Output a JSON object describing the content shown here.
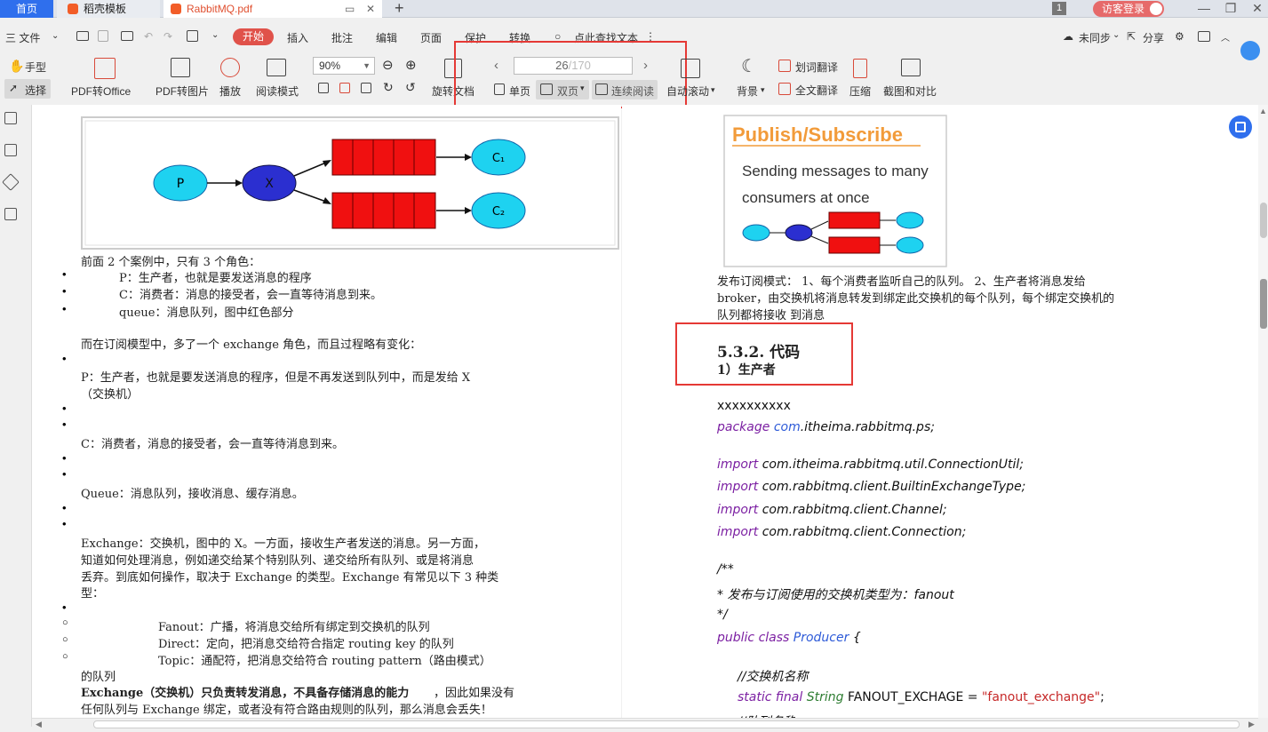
{
  "tabs": {
    "home": "首页",
    "template": "稻壳模板",
    "pdf": "RabbitMQ.pdf",
    "add": "+"
  },
  "titlebar": {
    "badge": "1",
    "login": "访客登录"
  },
  "menubar": {
    "file": "三 文件",
    "items": [
      "开始",
      "插入",
      "批注",
      "编辑",
      "页面",
      "保护",
      "转换"
    ],
    "search": "点此查找文本",
    "sync": "未同步",
    "share": "分享"
  },
  "toolbar": {
    "hand": "手型",
    "select": "选择",
    "pdf_to_office": "PDF转Office",
    "pdf_to_image": "PDF转图片",
    "play": "播放",
    "read_mode": "阅读模式",
    "zoom": "90%",
    "rotate": "旋转文档",
    "page_current": "26",
    "page_total": "/170",
    "single": "单页",
    "double": "双页",
    "continuous": "连续阅读",
    "auto_scroll": "自动滚动",
    "background": "背景",
    "word_translate": "划词翻译",
    "full_translate": "全文翻译",
    "compress": "压缩",
    "screenshot_compare": "截图和对比"
  },
  "left_page": {
    "diagram": {
      "p": "P",
      "x": "X",
      "c1": "C₁",
      "c2": "C₂"
    },
    "lines": [
      "前面 2 个案例中，只有 3 个角色：",
      "P：生产者，也就是要发送消息的程序",
      "C：消费者：消息的接受者，会一直等待消息到来。",
      "queue：消息队列，图中红色部分",
      "而在订阅模型中，多了一个 exchange 角色，而且过程略有变化：",
      "P：生产者，也就是要发送消息的程序，但是不再发送到队列中，而是发给 X",
      "（交换机）",
      "C：消费者，消息的接受者，会一直等待消息到来。",
      "Queue：消息队列，接收消息、缓存消息。",
      "Exchange：交换机，图中的 X。一方面，接收生产者发送的消息。另一方面，",
      "知道如何处理消息，例如递交给某个特别队列、递交给所有队列、或是将消息",
      "丢弃。到底如何操作，取决于 Exchange 的类型。Exchange 有常见以下 3 种类",
      "型：",
      "Fanout：广播，将消息交给所有绑定到交换机的队列",
      "Direct：定向，把消息交给符合指定 routing key 的队列",
      "Topic：通配符，把消息交给符合 routing pattern（路由模式）",
      "的队列",
      "Exchange（交换机）只负责转发消息，不具备存储消息的能力",
      "，因此如果没有",
      "任何队列与 Exchange 绑定，或者没有符合路由规则的队列，那么消息会丢失！"
    ]
  },
  "right_page": {
    "card_title": "Publish/Subscribe",
    "card_text1": "Sending messages to many",
    "card_text2": "consumers at once",
    "desc1": "发布订阅模式： 1、每个消费者监听自己的队列。 2、生产者将消息发给",
    "desc2": "broker，由交换机将消息转发到绑定此交换机的每个队列，每个绑定交换机的",
    "desc3": "队列都将接收 到消息",
    "heading": "5.3.2. 代码",
    "subheading": "1）生产者",
    "code": {
      "l0": "xxxxxxxxxx",
      "l1a": "package ",
      "l1b": "com",
      "l1c": ".itheima.rabbitmq.ps;",
      "imp": "import ",
      "i1": "com.itheima.rabbitmq.util.ConnectionUtil;",
      "i2": "com.rabbitmq.client.BuiltinExchangeType;",
      "i3": "com.rabbitmq.client.Channel;",
      "i4": "com.rabbitmq.client.Connection;",
      "c1": "/**",
      "c2": " * 发布与订阅使用的交换机类型为：fanout",
      "c3": " */",
      "pc": "public class ",
      "prod": "Producer",
      "brace": " {",
      "cm": "//交换机名称",
      "sf": "static final ",
      "strt": "String",
      "fe": " FANOUT_EXCHAGE = ",
      "fev": "\"fanout_exchange\"",
      "semi": ";",
      "cm2": "//队列名称"
    }
  }
}
